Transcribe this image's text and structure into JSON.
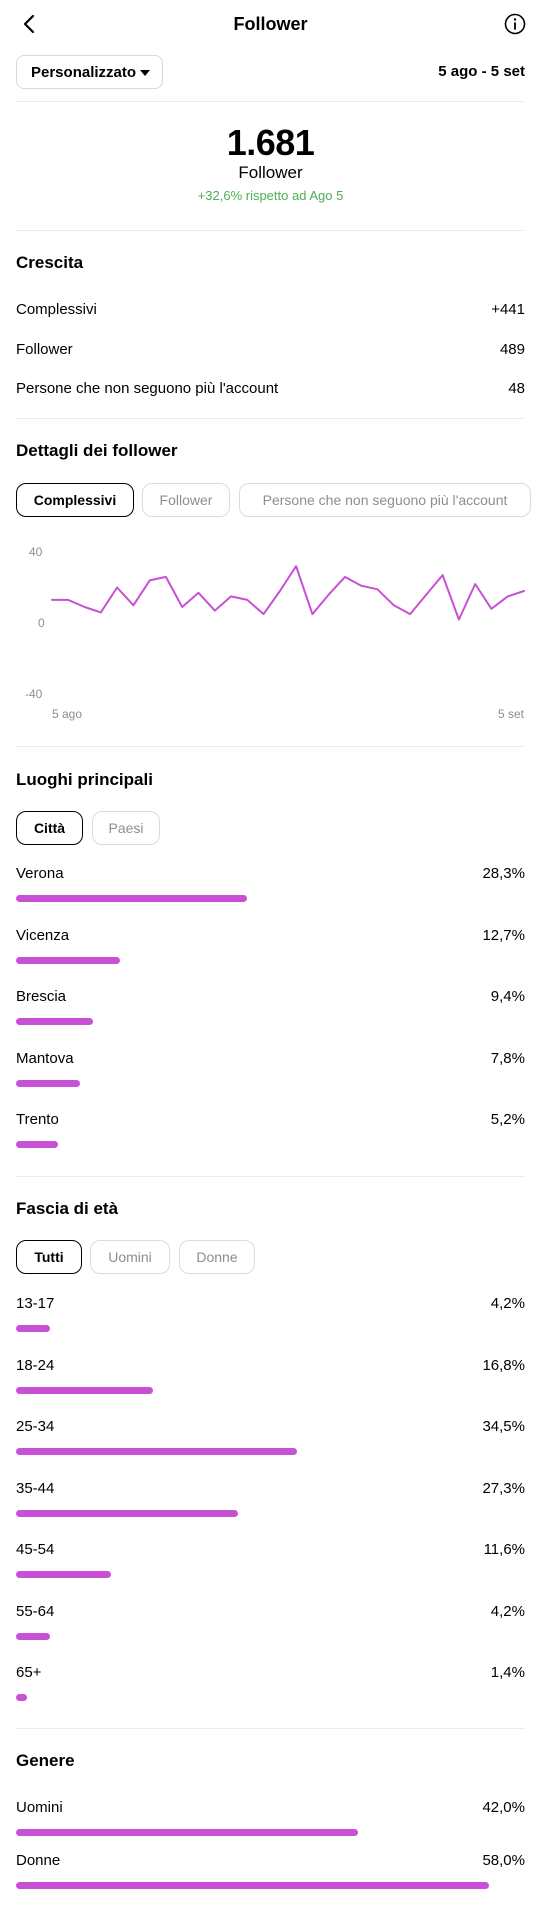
{
  "header": {
    "title": "Follower",
    "back_icon": "chevron-left-icon",
    "info_icon": "info-circle-icon"
  },
  "filter": {
    "dropdown_label": "Personalizzato",
    "date_range": "5 ago - 5 set"
  },
  "summary": {
    "total": "1.681",
    "label": "Follower",
    "comparison": "+32,6% rispetto ad Ago 5",
    "comparison_color": "#4caf50"
  },
  "growth": {
    "title": "Crescita",
    "rows": [
      {
        "label": "Complessivi",
        "value": "+441"
      },
      {
        "label": "Follower",
        "value": "489"
      },
      {
        "label": "Persone che non seguono più l'account",
        "value": "48"
      }
    ]
  },
  "details": {
    "title": "Dettagli dei follower",
    "tabs": [
      "Complessivi",
      "Follower",
      "Persone che non seguono più l'account"
    ],
    "active_tab": 0
  },
  "chart_data": {
    "type": "line",
    "x_start_label": "5 ago",
    "x_end_label": "5 set",
    "yticks": [
      "40",
      "0",
      "-40"
    ],
    "ylim": [
      -40,
      40
    ],
    "line_color": "#c850d5",
    "values": [
      13,
      13,
      9,
      6,
      20,
      10,
      24,
      26,
      9,
      17,
      7,
      15,
      13,
      5,
      18,
      32,
      5,
      16,
      26,
      21,
      19,
      10,
      5,
      16,
      27,
      2,
      22,
      8,
      15,
      18
    ]
  },
  "locations": {
    "title": "Luoghi principali",
    "tabs": [
      "Città",
      "Paesi"
    ],
    "active_tab": 0,
    "items": [
      {
        "label": "Verona",
        "value": "28,3%",
        "pct": 28.3
      },
      {
        "label": "Vicenza",
        "value": "12,7%",
        "pct": 12.7
      },
      {
        "label": "Brescia",
        "value": "9,4%",
        "pct": 9.4
      },
      {
        "label": "Mantova",
        "value": "7,8%",
        "pct": 7.8
      },
      {
        "label": "Trento",
        "value": "5,2%",
        "pct": 5.2
      }
    ]
  },
  "age": {
    "title": "Fascia di età",
    "tabs": [
      "Tutti",
      "Uomini",
      "Donne"
    ],
    "active_tab": 0,
    "items": [
      {
        "label": "13-17",
        "value": "4,2%",
        "pct": 4.2
      },
      {
        "label": "18-24",
        "value": "16,8%",
        "pct": 16.8
      },
      {
        "label": "25-34",
        "value": "34,5%",
        "pct": 34.5
      },
      {
        "label": "35-44",
        "value": "27,3%",
        "pct": 27.3
      },
      {
        "label": "45-54",
        "value": "11,6%",
        "pct": 11.6
      },
      {
        "label": "55-64",
        "value": "4,2%",
        "pct": 4.2
      },
      {
        "label": "65+",
        "value": "1,4%",
        "pct": 1.4
      }
    ]
  },
  "gender": {
    "title": "Genere",
    "items": [
      {
        "label": "Uomini",
        "value": "42,0%",
        "pct": 42.0
      },
      {
        "label": "Donne",
        "value": "58,0%",
        "pct": 58.0
      }
    ]
  },
  "bar_color": "#c850d5"
}
